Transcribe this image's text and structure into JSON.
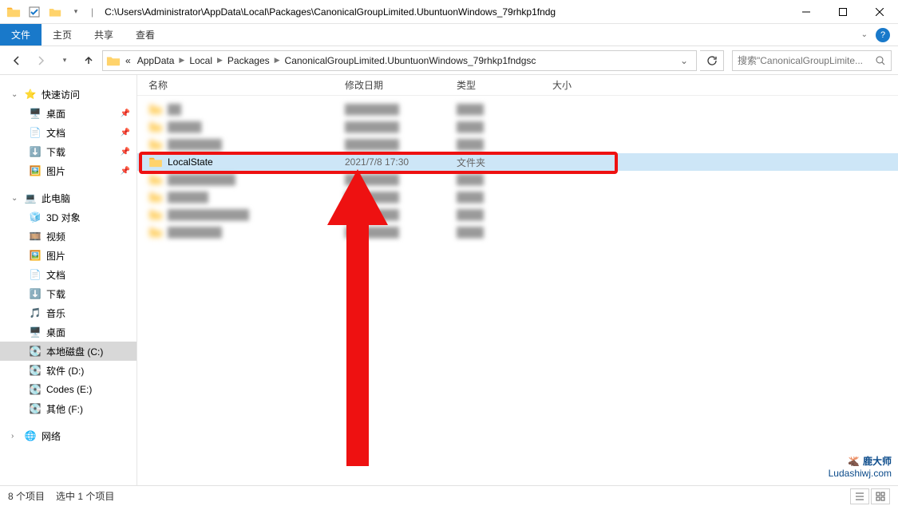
{
  "title_path": "C:\\Users\\Administrator\\AppData\\Local\\Packages\\CanonicalGroupLimited.UbuntuonWindows_79rhkp1fndg",
  "ribbon": {
    "file": "文件",
    "home": "主页",
    "share": "共享",
    "view": "查看"
  },
  "breadcrumb": {
    "prefix": "«",
    "items": [
      "AppData",
      "Local",
      "Packages",
      "CanonicalGroupLimited.UbuntuonWindows_79rhkp1fndgsc"
    ]
  },
  "search_placeholder": "搜索\"CanonicalGroupLimite...",
  "sidebar": {
    "quick": "快速访问",
    "desktop": "桌面",
    "documents": "文档",
    "downloads": "下载",
    "pictures": "图片",
    "thispc": "此电脑",
    "objects3d": "3D 对象",
    "videos": "视频",
    "pictures2": "图片",
    "documents2": "文档",
    "downloads2": "下载",
    "music": "音乐",
    "desktop2": "桌面",
    "drive_c": "本地磁盘 (C:)",
    "drive_d": "软件 (D:)",
    "drive_e": "Codes (E:)",
    "drive_f": "其他 (F:)",
    "network": "网络"
  },
  "columns": {
    "name": "名称",
    "date": "修改日期",
    "type": "类型",
    "size": "大小"
  },
  "rows": [
    {
      "name": "██",
      "date": "████████",
      "type": "████",
      "blur": true
    },
    {
      "name": "█████",
      "date": "████████",
      "type": "████",
      "blur": true
    },
    {
      "name": "████████",
      "date": "████████",
      "type": "████",
      "blur": true
    },
    {
      "name": "LocalState",
      "date": "2021/7/8 17:30",
      "type": "文件夹",
      "highlight": true
    },
    {
      "name": "██████████",
      "date": "████████",
      "type": "████",
      "blur": true
    },
    {
      "name": "██████",
      "date": "████████",
      "type": "████",
      "blur": true
    },
    {
      "name": "████████████",
      "date": "████████",
      "type": "████",
      "blur": true
    },
    {
      "name": "████████",
      "date": "████████",
      "type": "████",
      "blur": true
    }
  ],
  "status": {
    "count": "8 个项目",
    "selected": "选中 1 个项目"
  },
  "watermark": {
    "big": "鹿大师",
    "small": "Ludashiwj.com"
  }
}
